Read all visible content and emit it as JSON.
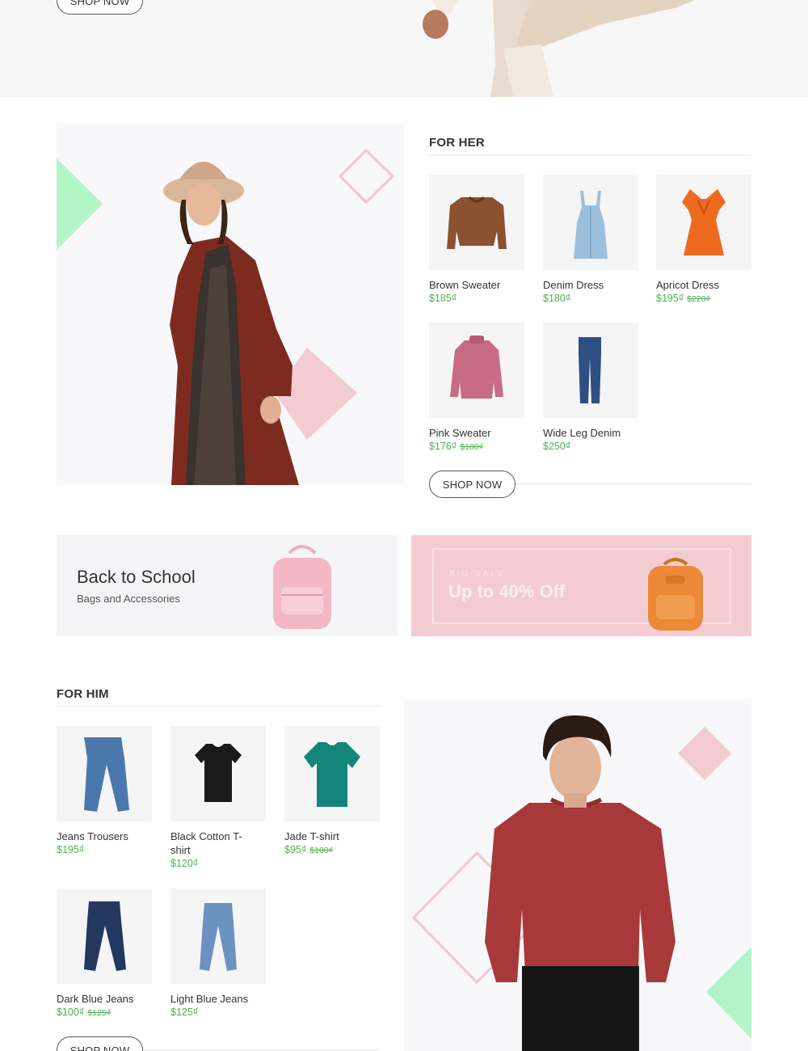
{
  "hero": {
    "shop_now": "SHOP NOW"
  },
  "for_her": {
    "title": "FOR HER",
    "shop_now": "SHOP NOW",
    "products": [
      {
        "name": "Brown Sweater",
        "price": "$185₫",
        "old_price": ""
      },
      {
        "name": "Denim Dress",
        "price": "$180₫",
        "old_price": ""
      },
      {
        "name": "Apricot Dress",
        "price": "$195₫",
        "old_price": "$220₫"
      },
      {
        "name": "Pink Sweater",
        "price": "$176₫",
        "old_price": "$180₫"
      },
      {
        "name": "Wide Leg Denim",
        "price": "$250₫",
        "old_price": ""
      }
    ]
  },
  "banners": {
    "school_title": "Back to School",
    "school_sub": "Bags and Accessories",
    "sale_kicker": "BIG SALE",
    "sale_title": "Up to 40% Off"
  },
  "for_him": {
    "title": "FOR HIM",
    "shop_now": "SHOP NOW",
    "products": [
      {
        "name": "Jeans Trousers",
        "price": "$195₫",
        "old_price": ""
      },
      {
        "name": "Black Cotton T-shirt",
        "price": "$120₫",
        "old_price": ""
      },
      {
        "name": "Jade T-shirt",
        "price": "$95₫",
        "old_price": "$100₫"
      },
      {
        "name": "Dark Blue Jeans",
        "price": "$100₫",
        "old_price": "$125₫"
      },
      {
        "name": "Light Blue Jeans",
        "price": "$125₫",
        "old_price": ""
      }
    ]
  },
  "colors": {
    "accent_green": "#4caf50",
    "mint": "#b4f5c8",
    "pink": "#f3ccd2",
    "orange": "#ec8a3a"
  }
}
